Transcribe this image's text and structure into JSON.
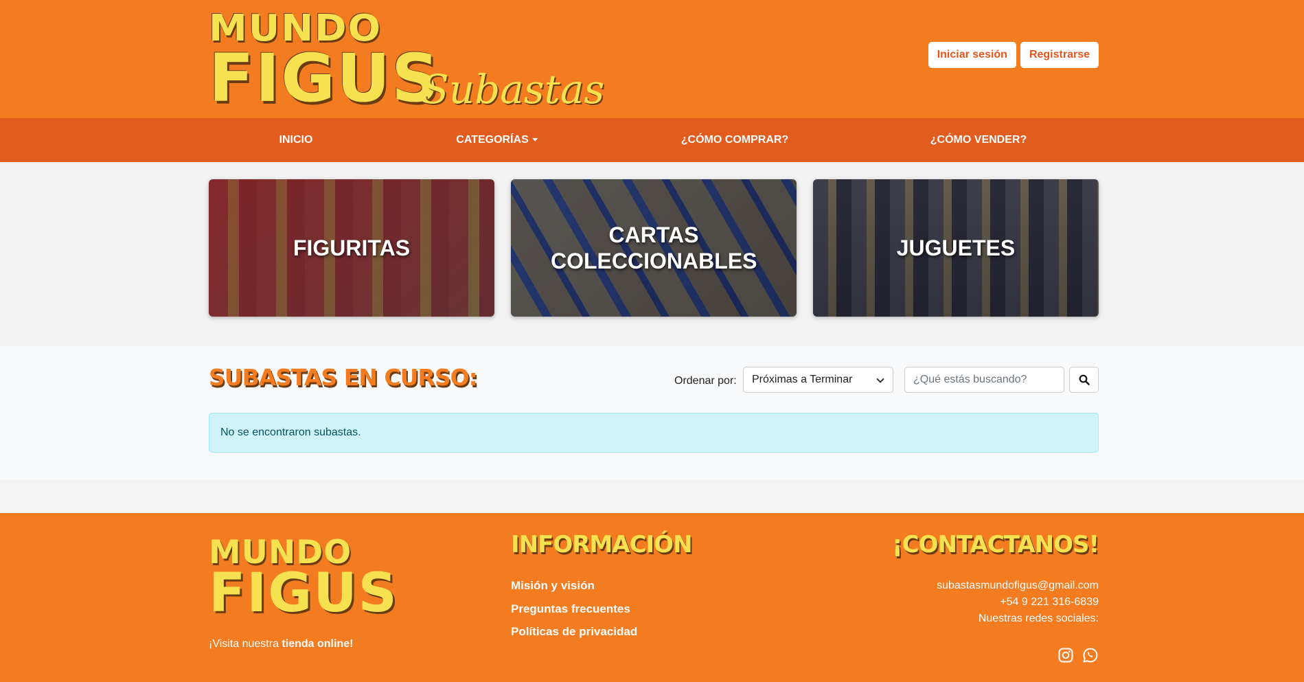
{
  "header": {
    "logo_line1": "MUNDO",
    "logo_line2": "FIGUS",
    "logo_sub": "Subastas",
    "login_label": "Iniciar sesión",
    "register_label": "Registrarse"
  },
  "nav": {
    "items": [
      {
        "label": "INICIO"
      },
      {
        "label": "CATEGORÍAS"
      },
      {
        "label": "¿CÓMO COMPRAR?"
      },
      {
        "label": "¿CÓMO VENDER?"
      }
    ]
  },
  "categories": [
    {
      "label": "FIGURITAS"
    },
    {
      "label": "CARTAS COLECCIONABLES"
    },
    {
      "label": "JUGUETES"
    }
  ],
  "auctions": {
    "title": "SUBASTAS EN CURSO:",
    "sort_label": "Ordenar por:",
    "sort_selected": "Próximas a Terminar",
    "search_placeholder": "¿Qué estás buscando?",
    "empty_message": "No se encontraron subastas."
  },
  "footer": {
    "logo_line1": "MUNDO",
    "logo_line2": "FIGUS",
    "visit_prefix": "¡Visita nuestra ",
    "visit_link": "tienda online!",
    "info_heading": "INFORMACIÓN",
    "links": [
      "Misión y visión",
      "Preguntas frecuentes",
      "Políticas de privacidad"
    ],
    "contact_heading": "¡CONTACTANOS!",
    "email": "subastasmundofigus@gmail.com",
    "phone": "+54 9 221 316-6839",
    "social_label": "Nuestras redes sociales:",
    "social_icons": [
      "instagram-icon",
      "whatsapp-icon"
    ]
  },
  "colors": {
    "brand_orange": "#f47c20",
    "nav_orange": "#e25c1e",
    "logo_yellow": "#f6e251",
    "alert_bg": "#cff4fc"
  }
}
